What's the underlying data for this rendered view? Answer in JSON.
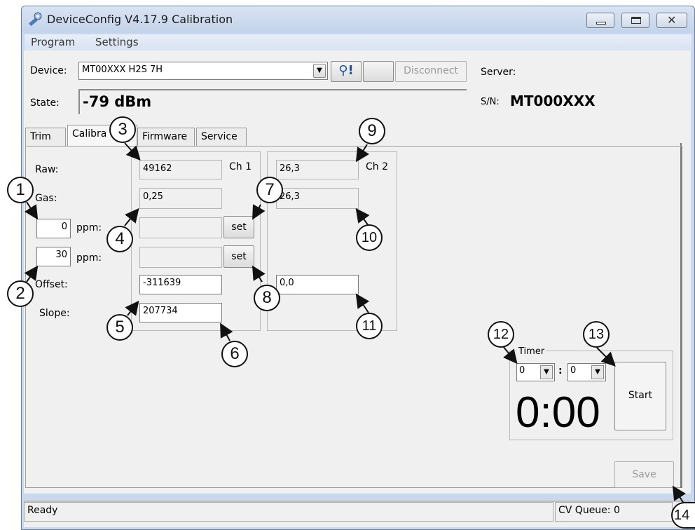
{
  "window": {
    "title": "DeviceConfig V4.17.9 Calibration",
    "menus": [
      "Program",
      "Settings"
    ]
  },
  "header": {
    "device_label": "Device:",
    "device_value": "MT00XXX  H2S 7H",
    "bt_button_label": "⚲!",
    "disconnect_label": "Disconnect",
    "state_label": "State:",
    "state_value": "-79 dBm",
    "server_label": "Server:",
    "sn_label": "S/N:",
    "sn_value": "MT000XXX"
  },
  "tabs": {
    "trim": "Trim",
    "calibration": "Calibra",
    "firmware": "Firmware",
    "service": "Service"
  },
  "calibration": {
    "raw_label": "Raw:",
    "gas_label": "Gas:",
    "ppm_label": "ppm:",
    "offset_label": "Offset:",
    "slope_label": "Slope:",
    "zero_point": "0",
    "span_point": "30",
    "set_label": "set",
    "ch1": {
      "label": "Ch 1",
      "raw": "49162",
      "gas": "0,25",
      "offset": "-311639",
      "slope": "207734"
    },
    "ch2": {
      "label": "Ch 2",
      "raw": "26,3",
      "gas": "26,3",
      "offset": "0,0"
    }
  },
  "timer": {
    "group_label": "Timer",
    "minutes_option": "0",
    "seconds_option": "0",
    "separator": ":",
    "display": "0:00",
    "start_label": "Start"
  },
  "save_label": "Save",
  "status": {
    "text": "Ready",
    "queue": "CV Queue: 0"
  },
  "callouts": [
    "1",
    "2",
    "3",
    "4",
    "5",
    "6",
    "7",
    "8",
    "9",
    "10",
    "11",
    "12",
    "13",
    "14"
  ]
}
